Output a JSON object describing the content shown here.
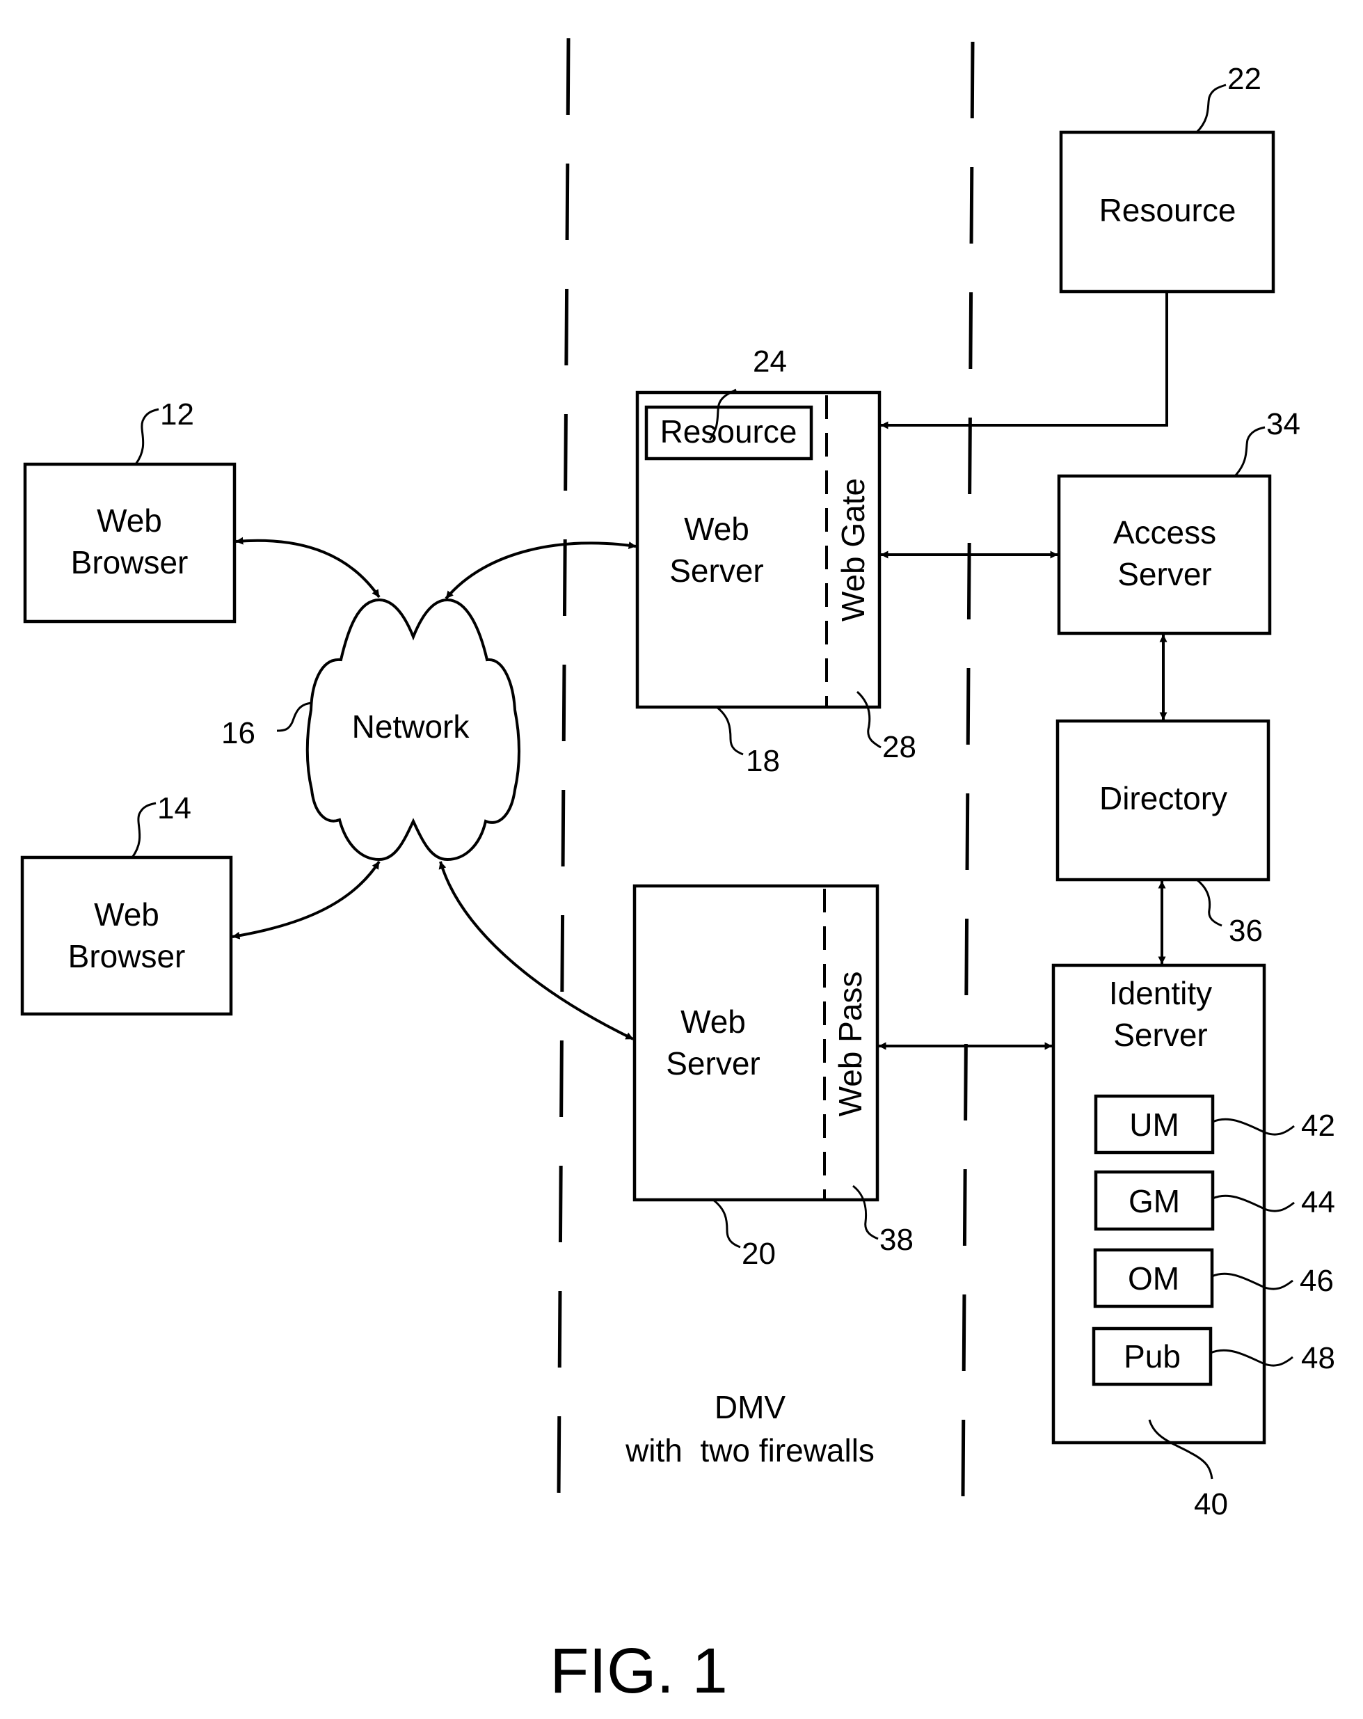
{
  "figure": {
    "caption": "FIG. 1",
    "zone_label_line1": "DMV",
    "zone_label_line2": "with  two firewalls"
  },
  "components": {
    "web_browser_1": {
      "line1": "Web",
      "line2": "Browser",
      "ref": "12"
    },
    "web_browser_2": {
      "line1": "Web",
      "line2": "Browser",
      "ref": "14"
    },
    "network": {
      "label": "Network",
      "ref": "16"
    },
    "web_server_1": {
      "line1": "Web",
      "line2": "Server",
      "ref": "18"
    },
    "web_server_1_resource": {
      "label": "Resource",
      "ref": "24"
    },
    "web_gate": {
      "label": "Web Gate",
      "ref": "28"
    },
    "web_server_2": {
      "line1": "Web",
      "line2": "Server",
      "ref": "20"
    },
    "web_pass": {
      "label": "Web Pass",
      "ref": "38"
    },
    "resource": {
      "label": "Resource",
      "ref": "22"
    },
    "access_server": {
      "line1": "Access",
      "line2": "Server",
      "ref": "34"
    },
    "directory": {
      "label": "Directory",
      "ref": "36"
    },
    "identity_server": {
      "line1": "Identity",
      "line2": "Server",
      "ref": "40",
      "modules": [
        {
          "label": "UM",
          "ref": "42"
        },
        {
          "label": "GM",
          "ref": "44"
        },
        {
          "label": "OM",
          "ref": "46"
        },
        {
          "label": "Pub",
          "ref": "48"
        }
      ]
    }
  },
  "connections": [
    {
      "from": "web_browser_1",
      "to": "network",
      "type": "bidirectional"
    },
    {
      "from": "web_browser_2",
      "to": "network",
      "type": "bidirectional"
    },
    {
      "from": "network",
      "to": "web_server_1",
      "type": "bidirectional"
    },
    {
      "from": "network",
      "to": "web_server_2",
      "type": "bidirectional"
    },
    {
      "from": "resource",
      "to": "web_gate",
      "type": "directed"
    },
    {
      "from": "web_gate",
      "to": "access_server",
      "type": "bidirectional"
    },
    {
      "from": "access_server",
      "to": "directory",
      "type": "bidirectional"
    },
    {
      "from": "directory",
      "to": "identity_server",
      "type": "bidirectional"
    },
    {
      "from": "web_pass",
      "to": "identity_server",
      "type": "bidirectional"
    }
  ]
}
